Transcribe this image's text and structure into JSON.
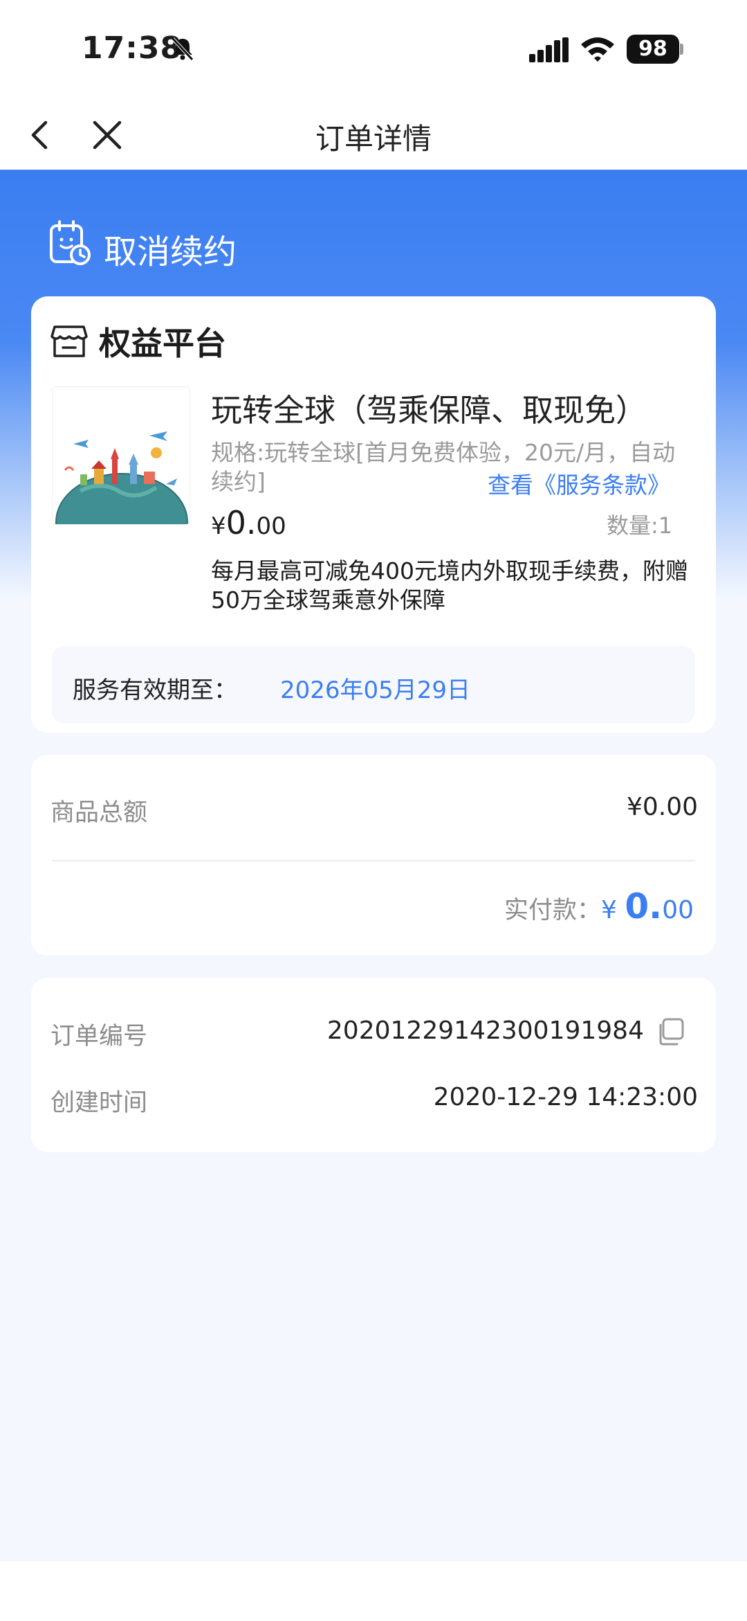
{
  "status_bar": {
    "time": "17:38",
    "battery": "98"
  },
  "nav": {
    "title": "订单详情"
  },
  "hero": {
    "action_label": "取消续约"
  },
  "product_card": {
    "store_name": "权益平台",
    "title": "玩转全球（驾乘保障、取现免）",
    "spec": "规格:玩转全球[首月免费体验，20元/月，自动续约]",
    "terms_link": "查看《服务条款》",
    "price_symbol": "¥",
    "price_int": "0.",
    "price_dec": "00",
    "quantity": "数量:1",
    "description": "每月最高可减免400元境内外取现手续费，附赠50万全球驾乘意外保障",
    "validity_label": "服务有效期至：",
    "validity_date": "2026年05月29日"
  },
  "totals_card": {
    "total_label": "商品总额",
    "total_value": "¥0.00",
    "paid_label": "实付款：",
    "paid_symbol": "¥ ",
    "paid_int": "0.",
    "paid_dec": "00"
  },
  "order_card": {
    "order_no_label": "订单编号",
    "order_no": "20201229142300191984",
    "created_label": "创建时间",
    "created_value": "2020-12-29 14:23:00"
  },
  "colors": {
    "accent": "#3b7ef2",
    "hero_top": "#3b7ef2",
    "page_bg": "#f4f7fe"
  },
  "icons": [
    "bell-mute-icon",
    "signal-icon",
    "wifi-icon",
    "back-icon",
    "close-icon",
    "calendar-clock-icon",
    "store-icon",
    "copy-icon"
  ]
}
